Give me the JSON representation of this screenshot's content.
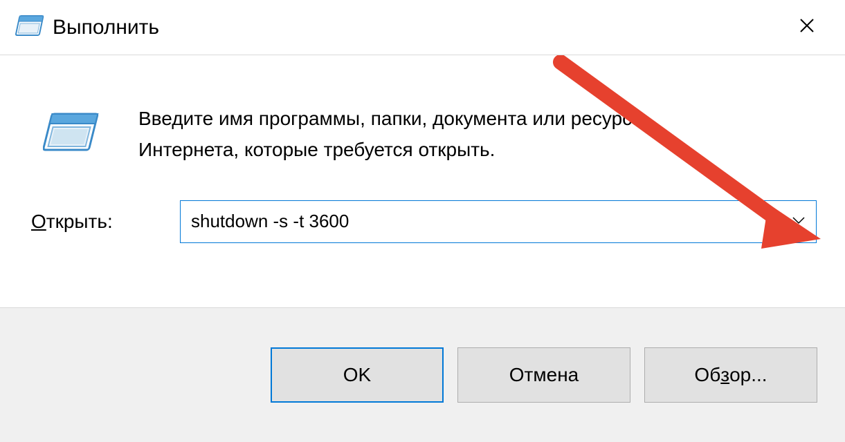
{
  "titlebar": {
    "title": "Выполнить"
  },
  "content": {
    "description": "Введите имя программы, папки, документа или ресурса Интернета, которые требуется открыть.",
    "open_label_underline": "О",
    "open_label_rest": "ткрыть:",
    "input_value": "shutdown -s -t 3600"
  },
  "buttons": {
    "ok": "OK",
    "cancel": "Отмена",
    "browse": "Обзор...",
    "browse_pre": "Об",
    "browse_under": "з",
    "browse_post": "ор..."
  }
}
